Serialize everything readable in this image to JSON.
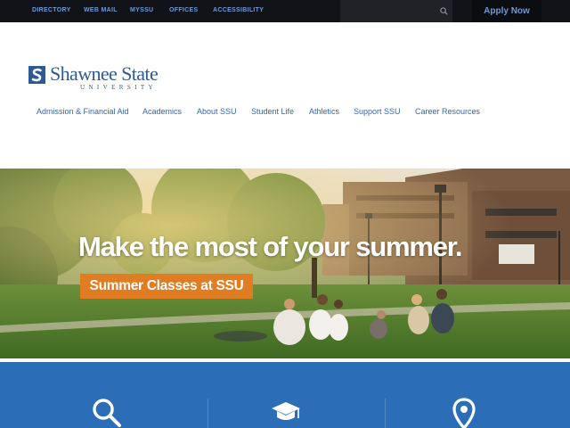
{
  "utility_nav": {
    "items": [
      "DIRECTORY",
      "WEB MAIL",
      "MYSSU",
      "OFFICES",
      "ACCESSIBILITY"
    ],
    "search": {
      "value": "",
      "placeholder": ""
    },
    "apply_label": "Apply Now"
  },
  "logo": {
    "name": "Shawnee State",
    "subtitle": "UNIVERSITY"
  },
  "main_nav": {
    "items": [
      "Admission & Financial Aid",
      "Academics",
      "About SSU",
      "Student Life",
      "Athletics",
      "Support SSU",
      "Career Resources"
    ]
  },
  "hero": {
    "headline": "Make the most of your summer.",
    "cta_label": "Summer Classes at SSU"
  },
  "feature_band": {
    "icons": [
      "search-icon",
      "graduation-cap-icon",
      "location-pin-icon"
    ]
  },
  "colors": {
    "topbar": "#111318",
    "utility_link": "#6f9ad6",
    "brand_blue": "#2f5a91",
    "nav_link": "#2f66b4",
    "cta_orange": "#e07c22",
    "band_blue": "#2b6db6"
  }
}
